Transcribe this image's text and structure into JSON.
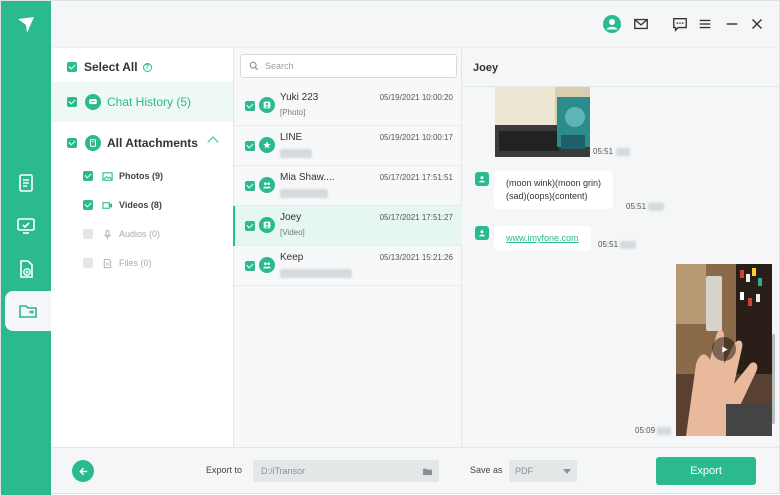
{
  "app": {
    "brand_color": "#2bb98e"
  },
  "rail": {
    "items": [
      {
        "icon": "document-icon"
      },
      {
        "icon": "monitor-transfer-icon"
      },
      {
        "icon": "file-add-icon"
      },
      {
        "icon": "folder-export-icon",
        "active": true
      }
    ]
  },
  "titlebar": {
    "icons": [
      "user-avatar-icon",
      "mail-icon",
      "feedback-icon",
      "menu-icon",
      "minimize-icon",
      "close-icon"
    ]
  },
  "filter": {
    "select_all": "Select All",
    "chat_history": "Chat History (5)",
    "all_attachments": "All Attachments",
    "attachments": [
      {
        "label": "Photos (9)",
        "checked": true
      },
      {
        "label": "Videos (8)",
        "checked": true
      },
      {
        "label": "Audios (0)",
        "checked": false
      },
      {
        "label": "Files (0)",
        "checked": false
      }
    ]
  },
  "chatlist": {
    "search_placeholder": "Search",
    "items": [
      {
        "name": "Yuki 223",
        "time": "05/19/2021 10:00:20",
        "sub": "[Photo]"
      },
      {
        "name": "LINE",
        "time": "05/19/2021 10:00:17",
        "sub": ""
      },
      {
        "name": "Mia Shaw....",
        "time": "05/17/2021 17:51:51",
        "sub": ""
      },
      {
        "name": "Joey",
        "time": "05/17/2021 17:51:27",
        "sub": "[Video]"
      },
      {
        "name": "Keep",
        "time": "05/13/2021 15:21:26",
        "sub": ""
      }
    ]
  },
  "conversation": {
    "title": "Joey",
    "messages": [
      {
        "type": "photo",
        "time": "05:51"
      },
      {
        "type": "text",
        "text_line1": "(moon wink)(moon grin)",
        "text_line2": "(sad)(oops)(content)",
        "time": "05:51"
      },
      {
        "type": "link",
        "text": "www.imyfone.com",
        "time": "05:51"
      },
      {
        "type": "video",
        "time": "05:09"
      }
    ]
  },
  "bottombar": {
    "export_to_label": "Export to",
    "export_path": "D:/iTransor",
    "save_as_label": "Save as",
    "format": "PDF",
    "export_button": "Export"
  }
}
